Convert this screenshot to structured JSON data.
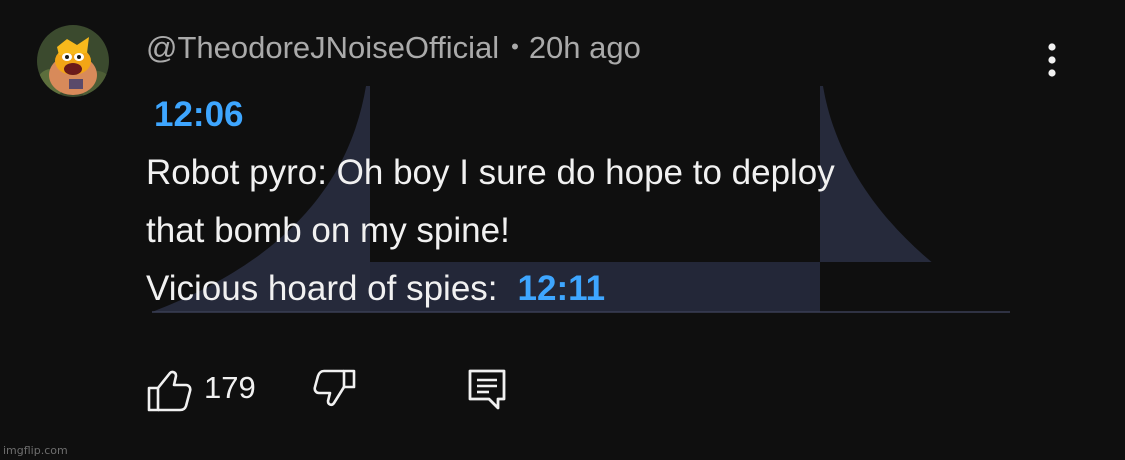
{
  "comment": {
    "author": "@TheodoreJNoiseOfficial",
    "separator": "•",
    "time_ago": "20h ago",
    "lines": {
      "timestamp_1": "12:06",
      "line_1": "Robot pyro: Oh boy I sure do hope to deploy",
      "line_2": "that bomb on my spine!",
      "line_3_prefix": "Vicious hoard of spies:",
      "timestamp_2": "12:11"
    },
    "likes": "179"
  },
  "icons": {
    "avatar": "cartoon-avatar",
    "menu": "vertical-dots-icon",
    "like": "thumbs-up-icon",
    "dislike": "thumbs-down-icon",
    "reply": "comment-icon"
  },
  "colors": {
    "background": "#0f0f0f",
    "text": "#f1f1f1",
    "secondary_text": "#aaaaaa",
    "link": "#3ea6ff"
  },
  "watermark": "imgflip.com"
}
